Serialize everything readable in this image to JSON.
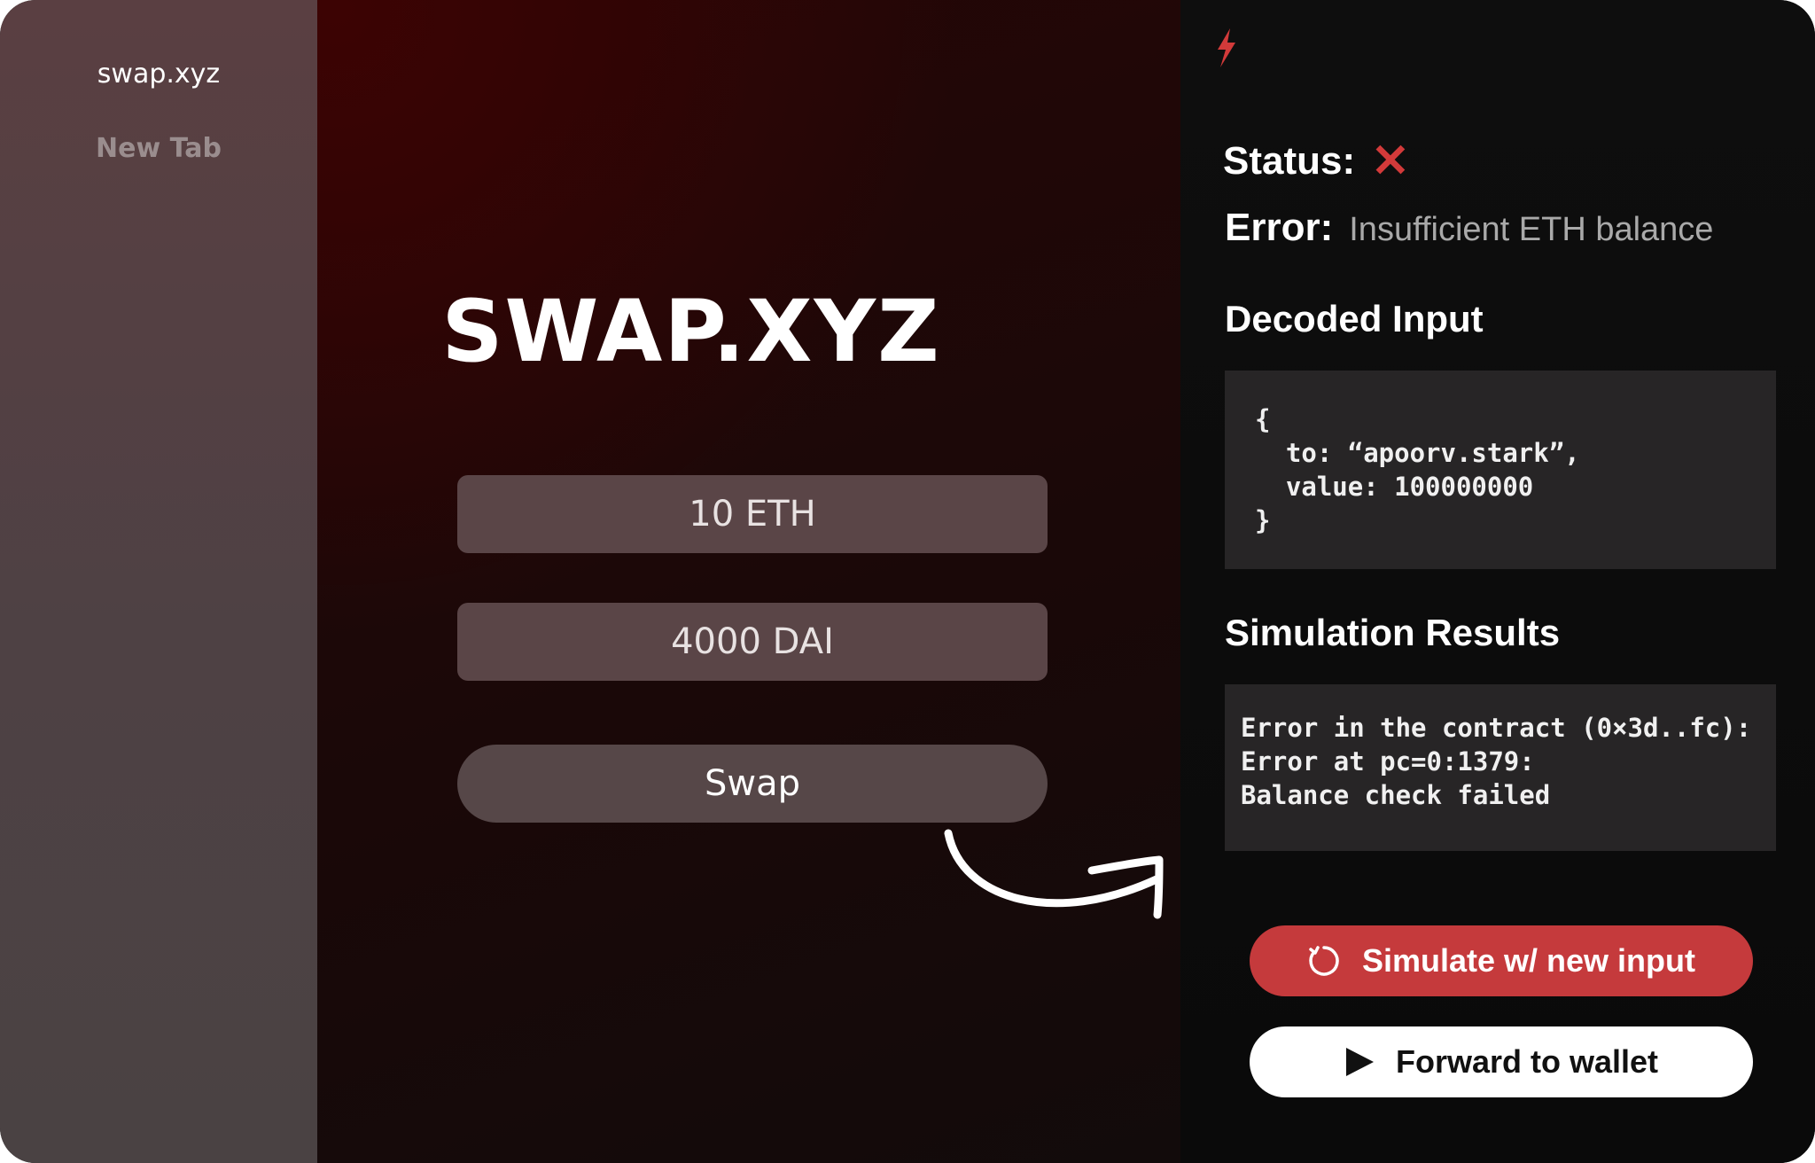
{
  "tabs": [
    {
      "label": "swap.xyz"
    },
    {
      "label": "New Tab"
    }
  ],
  "app": {
    "logo": "SWAP.XYZ",
    "from_value": "10 ETH",
    "to_value": "4000 DAI",
    "swap_label": "Swap"
  },
  "panel": {
    "icon": "lightning-bolt-icon",
    "status_label": "Status:",
    "status_icon": "x-icon",
    "error_label": "Error:",
    "error_message": "Insufficient ETH balance",
    "decoded_title": "Decoded Input",
    "decoded_code": "{\n  to: “apoorv.stark”,\n  value: 100000000\n}",
    "sim_title": "Simulation Results",
    "sim_code": "Error in the contract (0×3d..fc):\nError at pc=0:1379:\nBalance check failed",
    "simulate_label": "Simulate w/ new input",
    "forward_label": "Forward to wallet"
  },
  "colors": {
    "accent_red": "#c53a3c",
    "status_error": "#d23a3a",
    "field_bg": "#5a4547"
  }
}
